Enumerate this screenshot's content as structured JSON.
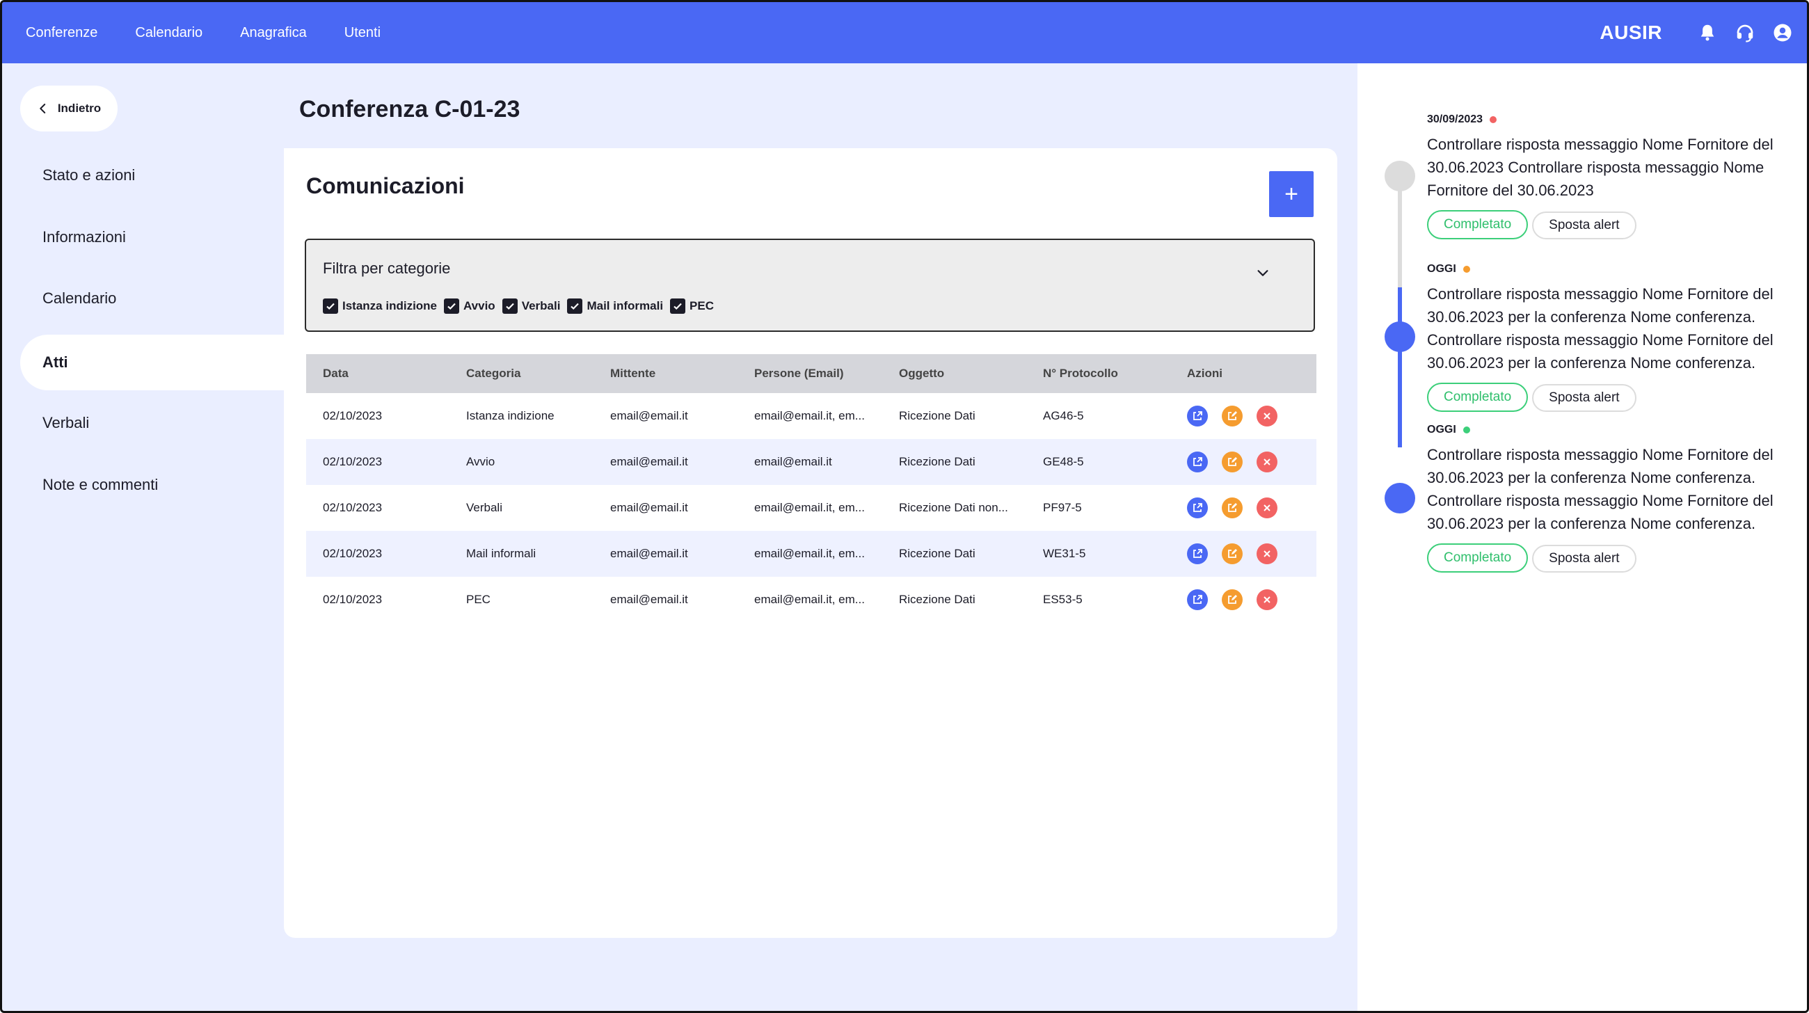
{
  "topbar": {
    "nav": [
      "Conferenze",
      "Calendario",
      "Anagrafica",
      "Utenti"
    ],
    "brand": "AUSIR",
    "icons": [
      "bell-icon",
      "headset-icon",
      "user-icon"
    ]
  },
  "sidebar": {
    "back_label": "Indietro",
    "items": [
      {
        "label": "Stato e azioni",
        "active": false
      },
      {
        "label": "Informazioni",
        "active": false
      },
      {
        "label": "Calendario",
        "active": false
      },
      {
        "label": "Atti",
        "active": true
      },
      {
        "label": "Verbali",
        "active": false
      },
      {
        "label": "Note e commenti",
        "active": false
      }
    ]
  },
  "page": {
    "title": "Conferenza C-01-23"
  },
  "card": {
    "title": "Comunicazioni",
    "add_label": "+",
    "filter": {
      "title": "Filtra per categorie",
      "categories": [
        {
          "label": "Istanza indizione",
          "checked": true
        },
        {
          "label": "Avvio",
          "checked": true
        },
        {
          "label": "Verbali",
          "checked": true
        },
        {
          "label": "Mail informali",
          "checked": true
        },
        {
          "label": "PEC",
          "checked": true
        }
      ]
    },
    "table": {
      "columns": [
        "Data",
        "Categoria",
        "Mittente",
        "Persone (Email)",
        "Oggetto",
        "N° Protocollo",
        "Azioni"
      ],
      "rows": [
        {
          "data": "02/10/2023",
          "categoria": "Istanza indizione",
          "mittente": "email@email.it",
          "persone": "email@email.it, em...",
          "oggetto": "Ricezione Dati",
          "protocollo": "AG46-5"
        },
        {
          "data": "02/10/2023",
          "categoria": "Avvio",
          "mittente": "email@email.it",
          "persone": "email@email.it",
          "oggetto": "Ricezione Dati",
          "protocollo": "GE48-5"
        },
        {
          "data": "02/10/2023",
          "categoria": "Verbali",
          "mittente": "email@email.it",
          "persone": "email@email.it, em...",
          "oggetto": "Ricezione Dati non...",
          "protocollo": "PF97-5"
        },
        {
          "data": "02/10/2023",
          "categoria": "Mail informali",
          "mittente": "email@email.it",
          "persone": "email@email.it, em...",
          "oggetto": "Ricezione Dati",
          "protocollo": "WE31-5"
        },
        {
          "data": "02/10/2023",
          "categoria": "PEC",
          "mittente": "email@email.it",
          "persone": "email@email.it, em...",
          "oggetto": "Ricezione Dati",
          "protocollo": "ES53-5"
        }
      ]
    }
  },
  "alerts": [
    {
      "date": "30/09/2023",
      "status_color": "#f26363",
      "text": "Controllare risposta messaggio Nome Fornitore del 30.06.2023 Controllare risposta messaggio Nome Fornitore del 30.06.2023",
      "done_label": "Completato",
      "move_label": "Sposta alert"
    },
    {
      "date": "OGGI",
      "status_color": "#f59c2f",
      "text": "Controllare risposta messaggio Nome Fornitore del 30.06.2023 per la conferenza Nome conferenza. Controllare risposta messaggio Nome Fornitore del 30.06.2023 per la conferenza Nome conferenza.",
      "done_label": "Completato",
      "move_label": "Sposta alert"
    },
    {
      "date": "OGGI",
      "status_color": "#3ccf7a",
      "text": "Controllare risposta messaggio Nome Fornitore del 30.06.2023 per la conferenza Nome conferenza. Controllare risposta messaggio Nome Fornitore del 30.06.2023 per la conferenza Nome conferenza.",
      "done_label": "Completato",
      "move_label": "Sposta alert"
    }
  ],
  "colors": {
    "primary": "#4a68f4",
    "background": "#eaeeff",
    "success": "#3ccf7a",
    "warning": "#f59c2f",
    "danger": "#f26363"
  }
}
